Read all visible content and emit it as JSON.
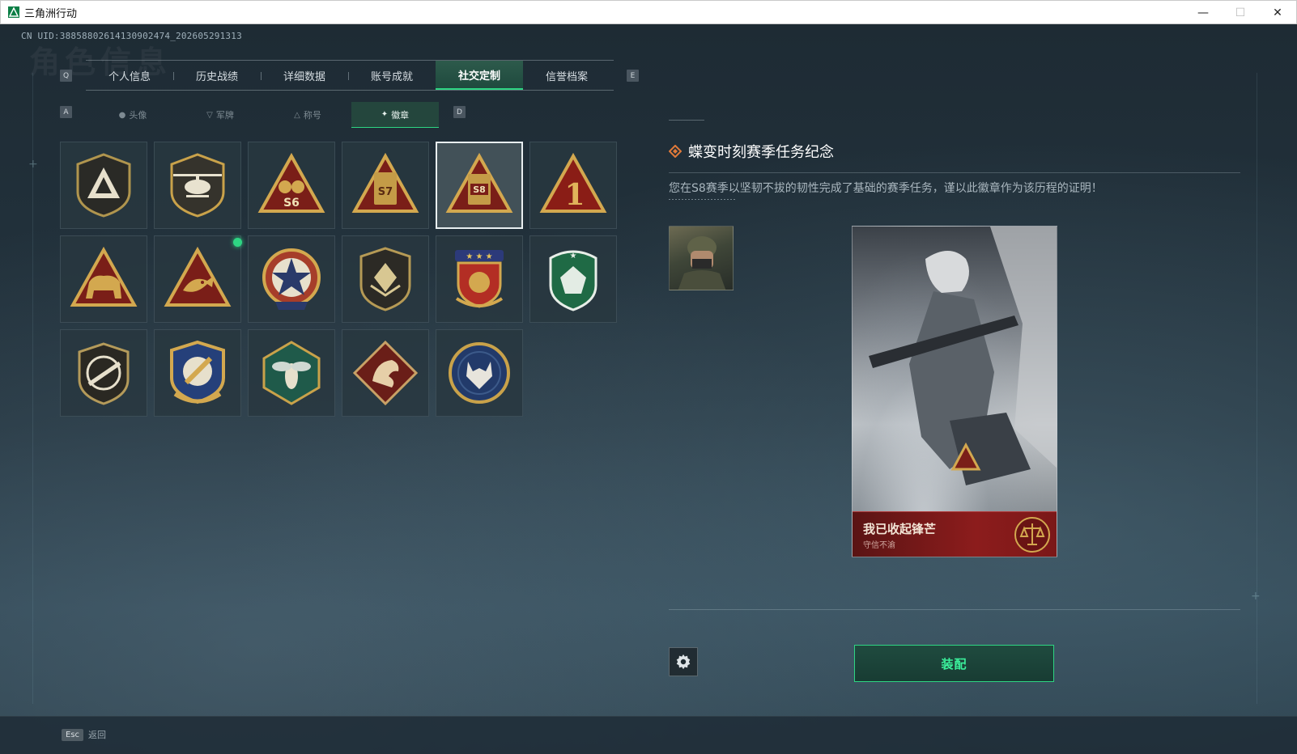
{
  "window": {
    "title": "三角洲行动",
    "controls": {
      "minimize": "—",
      "maximize": "☐",
      "close": "✕"
    }
  },
  "header": {
    "uid": "CN UID:3885880261413090247­4_202605291313",
    "bg_title": "角色信息"
  },
  "main_tabs": {
    "prev_key": "Q",
    "next_key": "E",
    "items": [
      {
        "label": "个人信息",
        "active": false
      },
      {
        "label": "历史战绩",
        "active": false
      },
      {
        "label": "详细数据",
        "active": false
      },
      {
        "label": "账号成就",
        "active": false
      },
      {
        "label": "社交定制",
        "active": true
      },
      {
        "label": "信誉档案",
        "active": false
      }
    ]
  },
  "sub_tabs": {
    "prev_key": "A",
    "next_key": "D",
    "items": [
      {
        "label": "头像",
        "icon": "person-icon",
        "active": false
      },
      {
        "label": "军牌",
        "icon": "dogtag-icon",
        "active": false
      },
      {
        "label": "称号",
        "icon": "triangle-icon",
        "active": false
      },
      {
        "label": "徽章",
        "icon": "badge-icon",
        "active": true
      }
    ]
  },
  "badges": [
    {
      "name": "delta-shield-badge",
      "selected": false,
      "new": false
    },
    {
      "name": "helicopter-badge",
      "selected": false,
      "new": false
    },
    {
      "name": "s6-season-badge",
      "selected": false,
      "new": false
    },
    {
      "name": "s7-season-badge",
      "selected": false,
      "new": false
    },
    {
      "name": "s8-season-badge",
      "selected": true,
      "new": false
    },
    {
      "name": "number-one-badge",
      "selected": false,
      "new": false
    },
    {
      "name": "elephant-badge",
      "selected": false,
      "new": false
    },
    {
      "name": "fish-badge",
      "selected": false,
      "new": true
    },
    {
      "name": "star-medal-badge",
      "selected": false,
      "new": false
    },
    {
      "name": "dark-shield-badge",
      "selected": false,
      "new": false
    },
    {
      "name": "star-crest-badge",
      "selected": false,
      "new": false
    },
    {
      "name": "green-gem-badge",
      "selected": false,
      "new": false
    },
    {
      "name": "rifle-shield-badge",
      "selected": false,
      "new": false
    },
    {
      "name": "missile-crest-badge",
      "selected": false,
      "new": false
    },
    {
      "name": "hornet-badge",
      "selected": false,
      "new": false
    },
    {
      "name": "dragon-badge",
      "selected": false,
      "new": false
    },
    {
      "name": "wolf-badge",
      "selected": false,
      "new": false
    }
  ],
  "detail": {
    "title": "蝶变时刻赛季任务纪念",
    "description": "您在S8赛季以坚韧不拔的韧性完成了基础的赛季任务，谨以此徽章作为该历程的证明！",
    "card_title": "我已收起锋芒",
    "card_subtitle": "守信不渝",
    "equip_label": "装配"
  },
  "footer": {
    "esc_key": "Esc",
    "back_label": "返回"
  },
  "colors": {
    "accent": "#2ed583",
    "gold": "#c9a24a",
    "card_banner": "#8c1c1c"
  }
}
